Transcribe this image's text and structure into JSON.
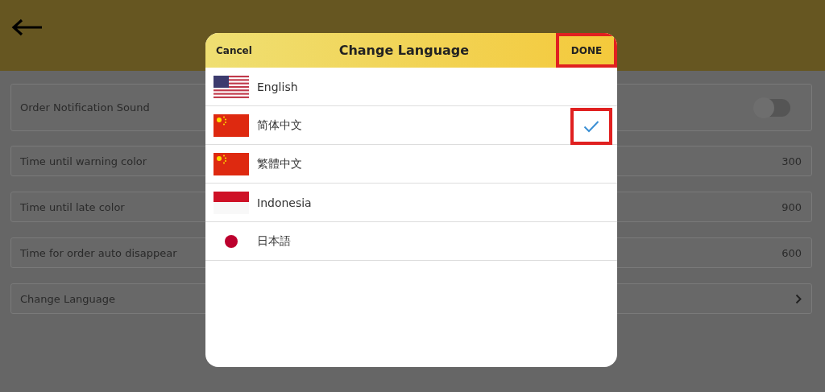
{
  "settings": [
    {
      "label": "Order Notification Sound",
      "kind": "toggle",
      "on": false
    },
    {
      "label": "Time until warning color",
      "kind": "value",
      "value": "300"
    },
    {
      "label": "Time until late color",
      "kind": "value",
      "value": "900"
    },
    {
      "label": "Time for order auto disappear",
      "kind": "value",
      "value": "600"
    },
    {
      "label": "Change Language",
      "kind": "link"
    }
  ],
  "dialog": {
    "title": "Change Language",
    "cancel": "Cancel",
    "done": {
      "label": "DONE",
      "highlighted": true
    },
    "languages": [
      {
        "label": "English",
        "kind": "us",
        "selected": false,
        "highlighted": false
      },
      {
        "label": "简体中文",
        "kind": "cn",
        "selected": true,
        "highlighted": true
      },
      {
        "label": "繁體中文",
        "kind": "cn",
        "selected": false,
        "highlighted": false
      },
      {
        "label": "Indonesia",
        "kind": "id",
        "selected": false,
        "highlighted": false
      },
      {
        "label": "日本語",
        "kind": "jp",
        "selected": false,
        "highlighted": false
      }
    ]
  }
}
